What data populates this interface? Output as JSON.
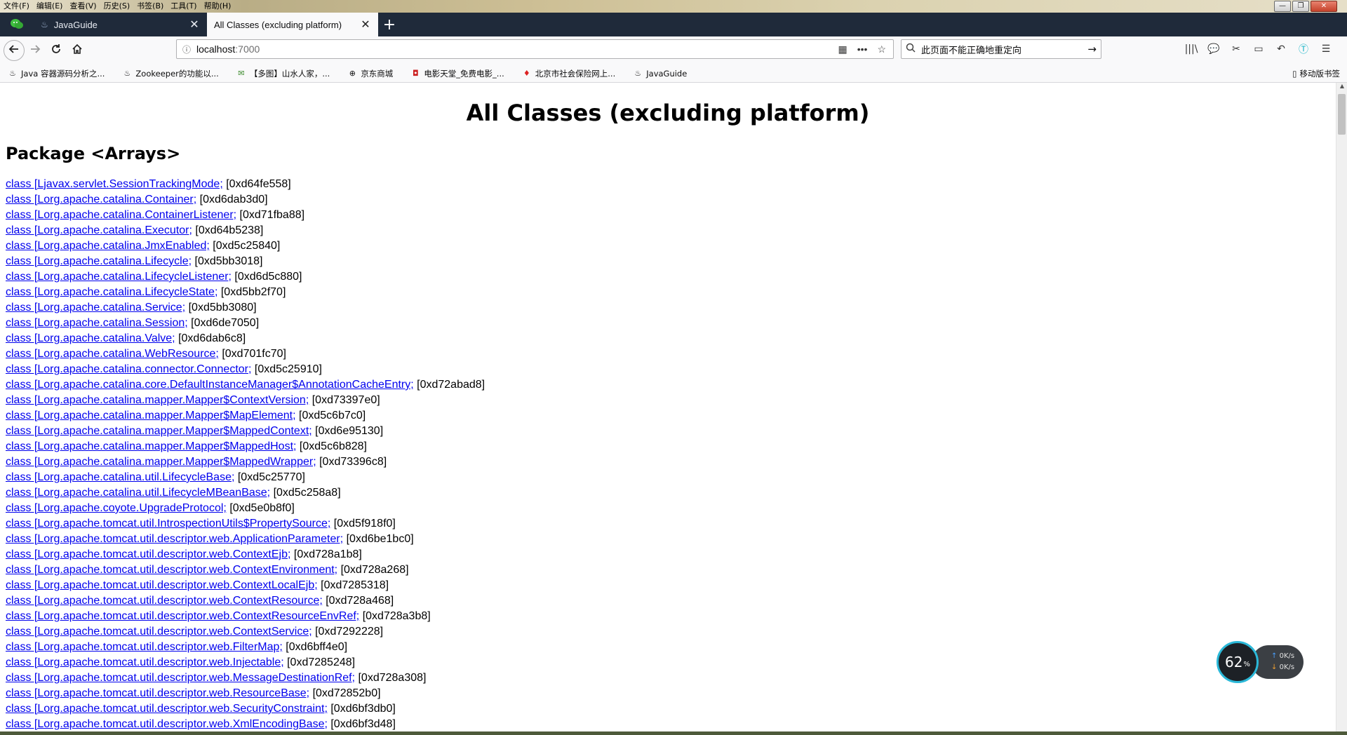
{
  "menubar": {
    "items": [
      "文件(F)",
      "编辑(E)",
      "查看(V)",
      "历史(S)",
      "书签(B)",
      "工具(T)",
      "帮助(H)"
    ],
    "window_controls": [
      "—",
      "❐",
      "✕"
    ]
  },
  "tabs": [
    {
      "label": "",
      "icon": "wechat-icon",
      "pinned": true
    },
    {
      "label": "JavaGuide",
      "icon": "javaguide-icon",
      "pinned": false,
      "active": false
    },
    {
      "label": "All Classes (excluding platform)",
      "icon": "",
      "pinned": false,
      "active": true
    }
  ],
  "navbar": {
    "url_host": "localhost",
    "url_port": ":7000",
    "search_text": "此页面不能正确地重定向"
  },
  "bookmarks": [
    {
      "label": "Java 容器源码分析之...",
      "icon": "bookmark-java-icon"
    },
    {
      "label": "Zookeeper的功能以...",
      "icon": "bookmark-zookeeper-icon"
    },
    {
      "label": "【多图】山水人家，...",
      "icon": "bookmark-shanshui-icon"
    },
    {
      "label": "京东商城",
      "icon": "globe-icon"
    },
    {
      "label": "电影天堂_免费电影_...",
      "icon": "bookmark-movie-icon"
    },
    {
      "label": "北京市社会保险网上...",
      "icon": "bookmark-beijing-icon"
    },
    {
      "label": "JavaGuide",
      "icon": "bookmark-javaguide-icon"
    }
  ],
  "mobile_bookmarks": "移动版书签",
  "page": {
    "title": "All Classes (excluding platform)",
    "package_title": "Package <Arrays>",
    "classes": [
      {
        "name": "class [Ljavax.servlet.SessionTrackingMode;",
        "addr": "[0xd64fe558]"
      },
      {
        "name": "class [Lorg.apache.catalina.Container;",
        "addr": "[0xd6dab3d0]"
      },
      {
        "name": "class [Lorg.apache.catalina.ContainerListener;",
        "addr": "[0xd71fba88]"
      },
      {
        "name": "class [Lorg.apache.catalina.Executor;",
        "addr": "[0xd64b5238]"
      },
      {
        "name": "class [Lorg.apache.catalina.JmxEnabled;",
        "addr": "[0xd5c25840]"
      },
      {
        "name": "class [Lorg.apache.catalina.Lifecycle;",
        "addr": "[0xd5bb3018]"
      },
      {
        "name": "class [Lorg.apache.catalina.LifecycleListener;",
        "addr": "[0xd6d5c880]"
      },
      {
        "name": "class [Lorg.apache.catalina.LifecycleState;",
        "addr": "[0xd5bb2f70]"
      },
      {
        "name": "class [Lorg.apache.catalina.Service;",
        "addr": "[0xd5bb3080]"
      },
      {
        "name": "class [Lorg.apache.catalina.Session;",
        "addr": "[0xd6de7050]"
      },
      {
        "name": "class [Lorg.apache.catalina.Valve;",
        "addr": "[0xd6dab6c8]"
      },
      {
        "name": "class [Lorg.apache.catalina.WebResource;",
        "addr": "[0xd701fc70]"
      },
      {
        "name": "class [Lorg.apache.catalina.connector.Connector;",
        "addr": "[0xd5c25910]"
      },
      {
        "name": "class [Lorg.apache.catalina.core.DefaultInstanceManager$AnnotationCacheEntry;",
        "addr": "[0xd72abad8]"
      },
      {
        "name": "class [Lorg.apache.catalina.mapper.Mapper$ContextVersion;",
        "addr": "[0xd73397e0]"
      },
      {
        "name": "class [Lorg.apache.catalina.mapper.Mapper$MapElement;",
        "addr": "[0xd5c6b7c0]"
      },
      {
        "name": "class [Lorg.apache.catalina.mapper.Mapper$MappedContext;",
        "addr": "[0xd6e95130]"
      },
      {
        "name": "class [Lorg.apache.catalina.mapper.Mapper$MappedHost;",
        "addr": "[0xd5c6b828]"
      },
      {
        "name": "class [Lorg.apache.catalina.mapper.Mapper$MappedWrapper;",
        "addr": "[0xd73396c8]"
      },
      {
        "name": "class [Lorg.apache.catalina.util.LifecycleBase;",
        "addr": "[0xd5c25770]"
      },
      {
        "name": "class [Lorg.apache.catalina.util.LifecycleMBeanBase;",
        "addr": "[0xd5c258a8]"
      },
      {
        "name": "class [Lorg.apache.coyote.UpgradeProtocol;",
        "addr": "[0xd5e0b8f0]"
      },
      {
        "name": "class [Lorg.apache.tomcat.util.IntrospectionUtils$PropertySource;",
        "addr": "[0xd5f918f0]"
      },
      {
        "name": "class [Lorg.apache.tomcat.util.descriptor.web.ApplicationParameter;",
        "addr": "[0xd6be1bc0]"
      },
      {
        "name": "class [Lorg.apache.tomcat.util.descriptor.web.ContextEjb;",
        "addr": "[0xd728a1b8]"
      },
      {
        "name": "class [Lorg.apache.tomcat.util.descriptor.web.ContextEnvironment;",
        "addr": "[0xd728a268]"
      },
      {
        "name": "class [Lorg.apache.tomcat.util.descriptor.web.ContextLocalEjb;",
        "addr": "[0xd7285318]"
      },
      {
        "name": "class [Lorg.apache.tomcat.util.descriptor.web.ContextResource;",
        "addr": "[0xd728a468]"
      },
      {
        "name": "class [Lorg.apache.tomcat.util.descriptor.web.ContextResourceEnvRef;",
        "addr": "[0xd728a3b8]"
      },
      {
        "name": "class [Lorg.apache.tomcat.util.descriptor.web.ContextService;",
        "addr": "[0xd7292228]"
      },
      {
        "name": "class [Lorg.apache.tomcat.util.descriptor.web.FilterMap;",
        "addr": "[0xd6bff4e0]"
      },
      {
        "name": "class [Lorg.apache.tomcat.util.descriptor.web.Injectable;",
        "addr": "[0xd7285248]"
      },
      {
        "name": "class [Lorg.apache.tomcat.util.descriptor.web.MessageDestinationRef;",
        "addr": "[0xd728a308]"
      },
      {
        "name": "class [Lorg.apache.tomcat.util.descriptor.web.ResourceBase;",
        "addr": "[0xd72852b0]"
      },
      {
        "name": "class [Lorg.apache.tomcat.util.descriptor.web.SecurityConstraint;",
        "addr": "[0xd6bf3db0]"
      },
      {
        "name": "class [Lorg.apache.tomcat.util.descriptor.web.XmlEncodingBase;",
        "addr": "[0xd6bf3d48]"
      }
    ]
  },
  "speed_widget": {
    "percent": "62",
    "percent_unit": "%",
    "upload": "0K/s",
    "download": "0K/s"
  },
  "colors": {
    "tabstrip_bg": "#1f2a3a",
    "link": "#0000ee",
    "widget_ring": "#2bb8d8"
  }
}
